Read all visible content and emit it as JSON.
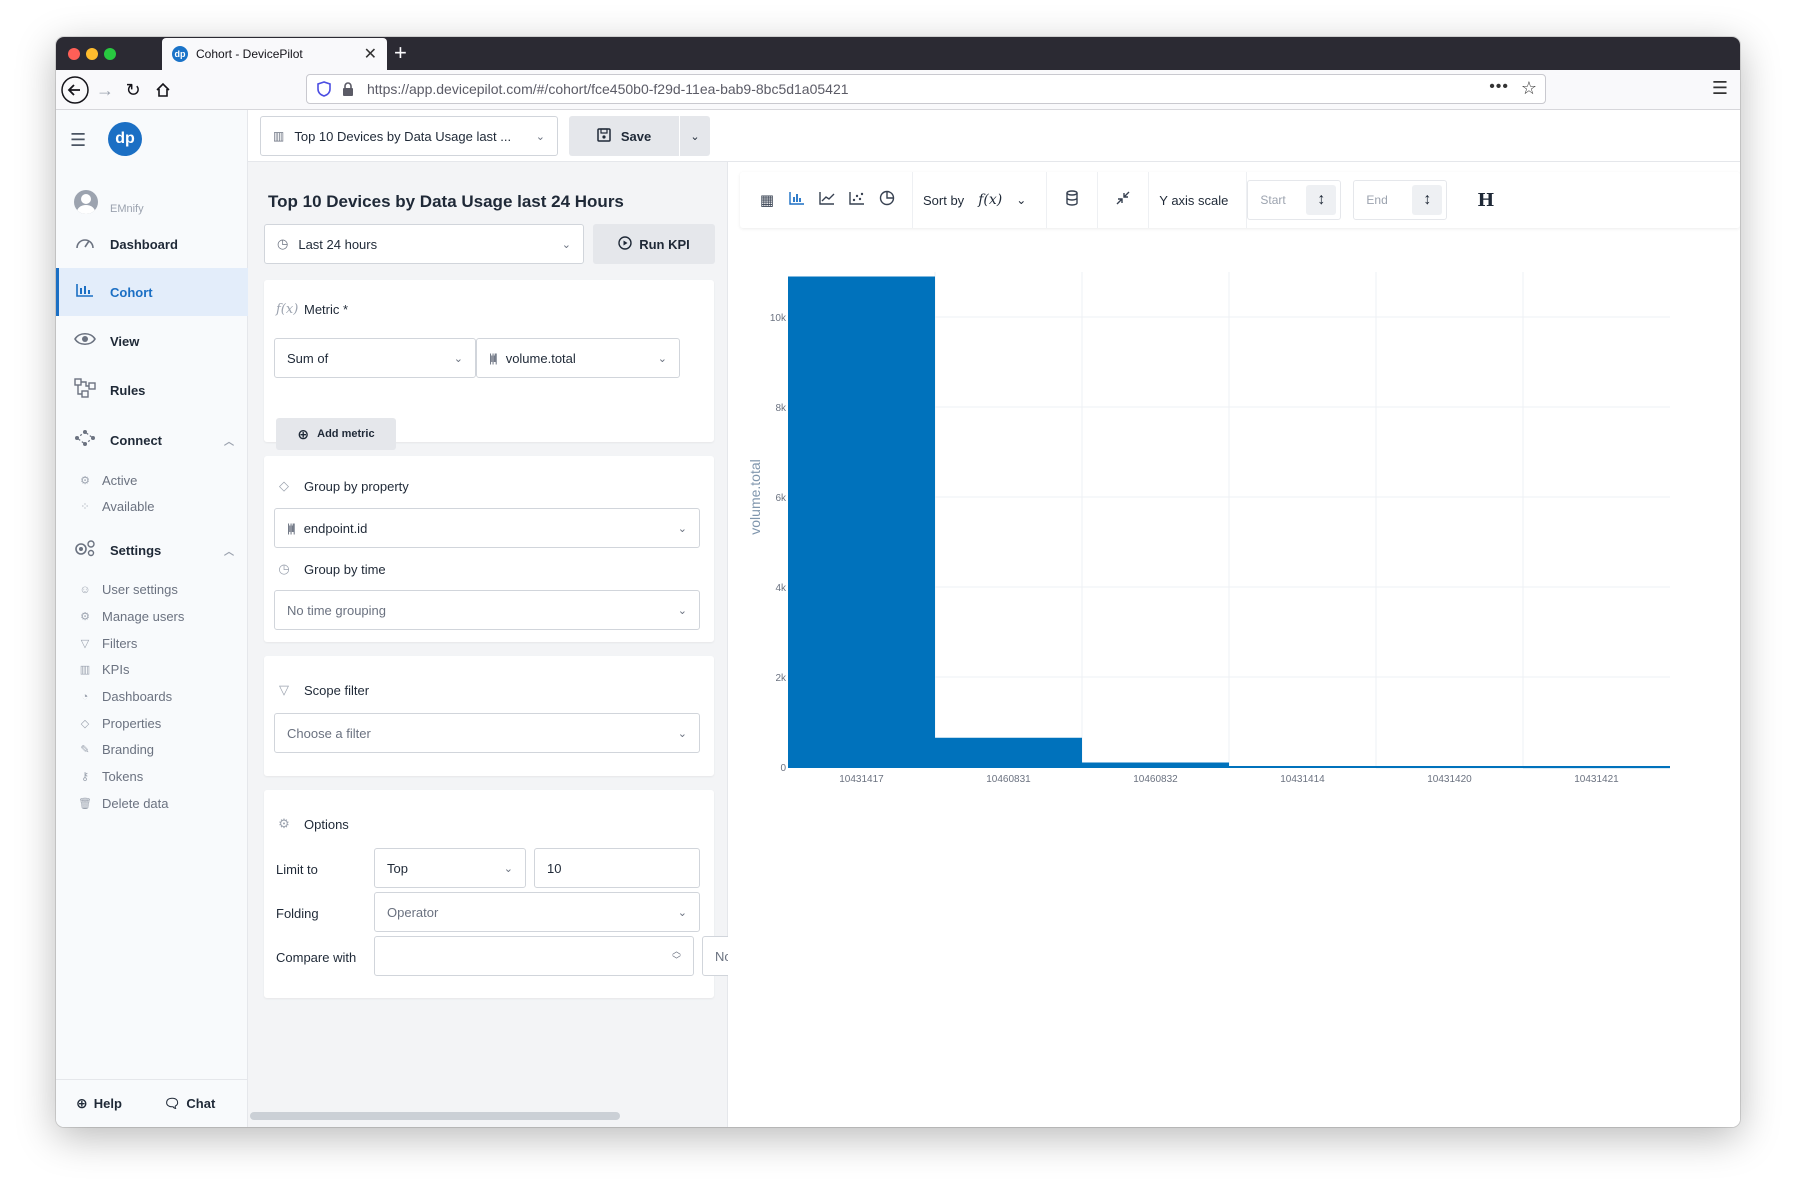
{
  "browser": {
    "tab_title": "Cohort - DevicePilot",
    "url": "https://app.devicepilot.com/#/cohort/fce450b0-f29d-11ea-bab9-8bc5d1a05421"
  },
  "sidebar": {
    "logo_text": "dp",
    "org_name": "EMnify",
    "nav": [
      {
        "label": "Dashboard",
        "icon": "gauge-icon"
      },
      {
        "label": "Cohort",
        "icon": "bar-chart-icon",
        "active": true
      },
      {
        "label": "View",
        "icon": "eye-icon"
      },
      {
        "label": "Rules",
        "icon": "flow-icon"
      },
      {
        "label": "Connect",
        "icon": "connect-icon"
      },
      {
        "label": "Settings",
        "icon": "gears-icon"
      }
    ],
    "connect_items": [
      "Active",
      "Available"
    ],
    "settings_items": [
      "User settings",
      "Manage users",
      "Filters",
      "KPIs",
      "Dashboards",
      "Properties",
      "Branding",
      "Tokens",
      "Delete data"
    ],
    "footer": {
      "help": "Help",
      "chat": "Chat"
    }
  },
  "topbar": {
    "kpi_name": "Top 10 Devices by Data Usage last ...",
    "save_label": "Save"
  },
  "panel": {
    "title": "Top 10 Devices by Data Usage last 24 Hours",
    "time_range": "Last 24 hours",
    "run_label": "Run KPI",
    "metric": {
      "label": "Metric *",
      "aggregation": "Sum of",
      "field": "volume.total",
      "add_label": "Add metric"
    },
    "group_by_property": {
      "label": "Group by property",
      "value": "endpoint.id"
    },
    "group_by_time": {
      "label": "Group by time",
      "value": "No time grouping"
    },
    "scope_filter": {
      "label": "Scope filter",
      "placeholder": "Choose a filter"
    },
    "options": {
      "label": "Options",
      "limit_label": "Limit to",
      "limit_mode": "Top",
      "limit_value": "10",
      "folding_label": "Folding",
      "folding_value": "Operator",
      "compare_label": "Compare with",
      "compare_value": "",
      "compare_extra": "No"
    }
  },
  "toolbar": {
    "sort_label": "Sort by",
    "sort_value": "f(x)",
    "yscale_label": "Y axis scale",
    "start_placeholder": "Start",
    "end_placeholder": "End",
    "h_label": "H"
  },
  "chart_data": {
    "type": "bar",
    "categories": [
      "10431417",
      "10460831",
      "10460832",
      "10431414",
      "10431420",
      "10431421"
    ],
    "values": [
      10900,
      650,
      100,
      15,
      10,
      8
    ],
    "ylabel": "volume.total",
    "ylim": [
      0,
      11000
    ],
    "yticks": [
      0,
      2000,
      4000,
      6000,
      8000,
      10000
    ],
    "ytick_labels": [
      "0",
      "2k",
      "4k",
      "6k",
      "8k",
      "10k"
    ],
    "color": "#0072bc",
    "grid": true
  }
}
